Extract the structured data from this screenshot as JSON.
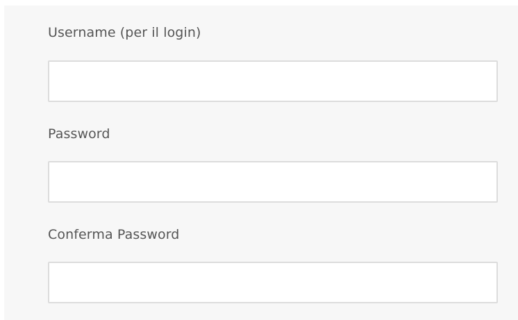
{
  "form": {
    "fields": [
      {
        "label": "Username (per il login)",
        "value": "",
        "placeholder": ""
      },
      {
        "label": "Password",
        "value": "",
        "placeholder": ""
      },
      {
        "label": "Conferma Password",
        "value": "",
        "placeholder": ""
      }
    ]
  }
}
